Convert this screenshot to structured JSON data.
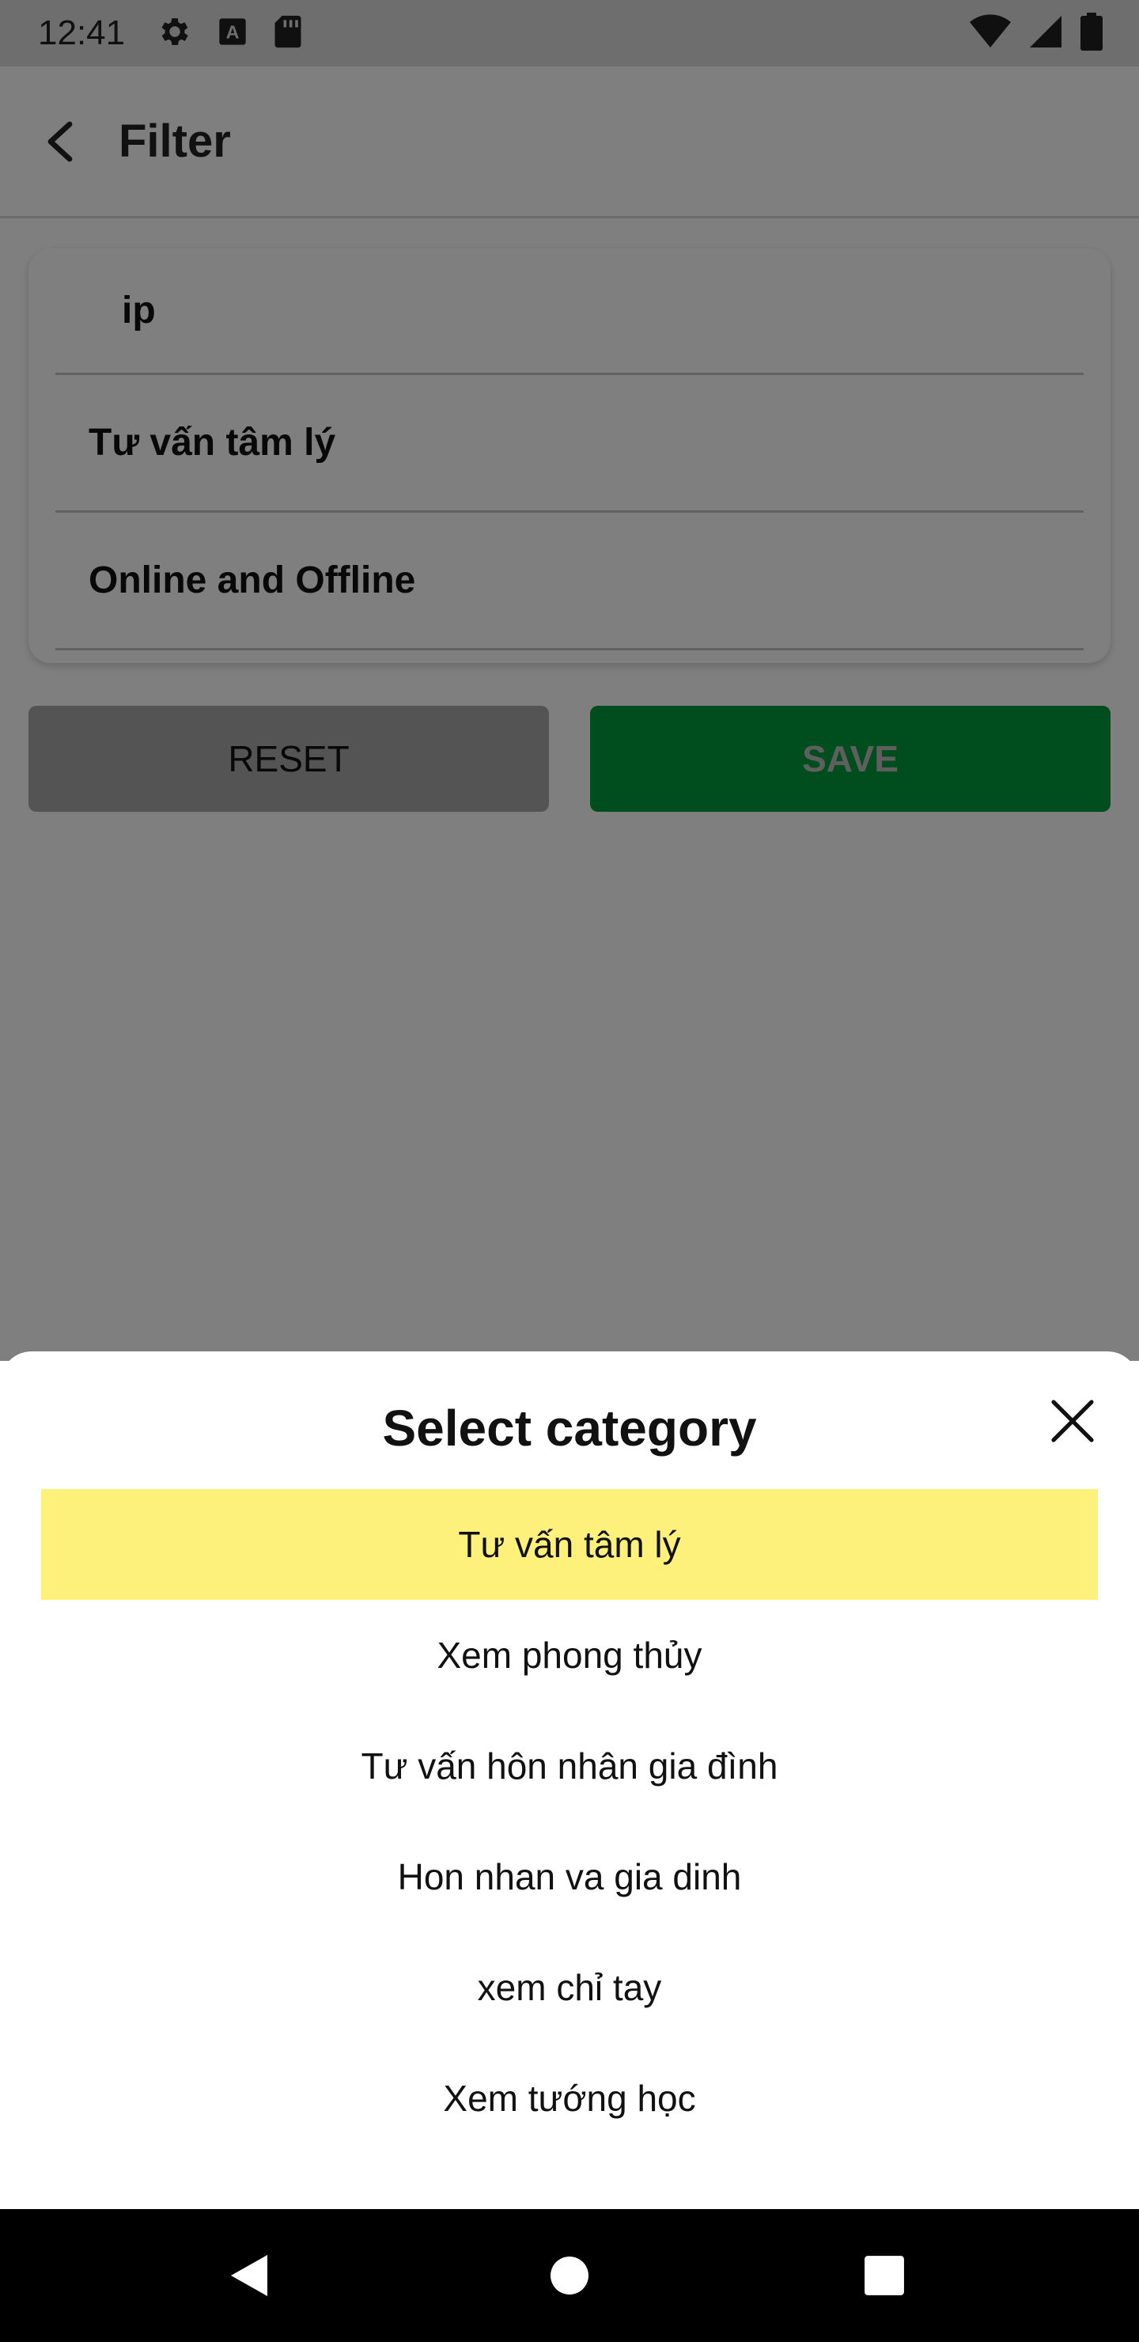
{
  "status_bar": {
    "time": "12:41",
    "left_icons": [
      "gear-icon",
      "a-badge-icon",
      "sd-card-icon"
    ],
    "right_icons": [
      "wifi-icon",
      "signal-icon",
      "battery-icon"
    ]
  },
  "app_bar": {
    "title": "Filter",
    "back_icon": "chevron-left-icon"
  },
  "filter_card": {
    "keyword_value": "ip",
    "category_value": "Tư vấn tâm lý",
    "mode_value": "Online and Offline"
  },
  "buttons": {
    "reset_label": "RESET",
    "save_label": "SAVE"
  },
  "sheet": {
    "title": "Select category",
    "close_icon": "close-icon",
    "items": [
      {
        "label": "Tư vấn tâm lý",
        "selected": true
      },
      {
        "label": "Xem phong thủy",
        "selected": false
      },
      {
        "label": "Tư vấn hôn nhân gia đình",
        "selected": false
      },
      {
        "label": "Hon nhan va gia dinh",
        "selected": false
      },
      {
        "label": "xem chỉ tay",
        "selected": false
      },
      {
        "label": "Xem tướng học",
        "selected": false
      }
    ]
  },
  "nav_bar": {
    "icons": [
      "back-triangle-icon",
      "home-circle-icon",
      "recents-square-icon"
    ]
  },
  "colors": {
    "save_button": "#019c3d",
    "selected_item": "#fdf17b",
    "scrim": "#000000"
  }
}
